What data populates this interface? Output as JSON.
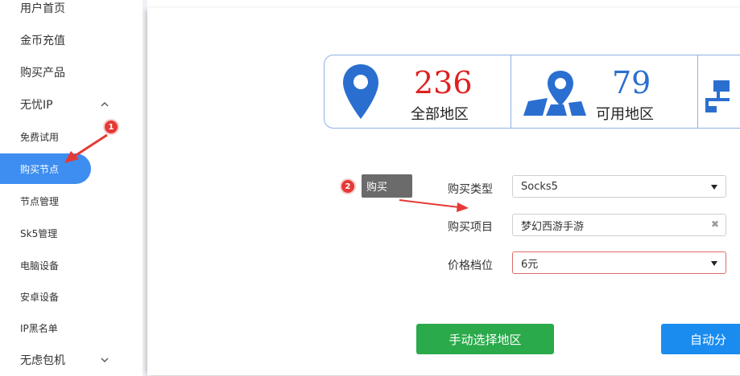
{
  "sidebar": {
    "items": [
      {
        "label": "用户首页",
        "icon": "",
        "sub": false
      },
      {
        "label": "金币充值",
        "icon": "",
        "sub": false
      },
      {
        "label": "购买产品",
        "icon": "",
        "sub": false
      },
      {
        "label": "无忧IP",
        "icon": "chevron-up-icon",
        "sub": false
      },
      {
        "label": "免费试用",
        "icon": "",
        "sub": true
      },
      {
        "label": "购买节点",
        "icon": "",
        "sub": true,
        "active": true
      },
      {
        "label": "节点管理",
        "icon": "",
        "sub": true
      },
      {
        "label": "Sk5管理",
        "icon": "",
        "sub": true
      },
      {
        "label": "电脑设备",
        "icon": "",
        "sub": true
      },
      {
        "label": "安卓设备",
        "icon": "",
        "sub": true
      },
      {
        "label": "IP黑名单",
        "icon": "",
        "sub": true
      },
      {
        "label": "无虑包机",
        "icon": "chevron-down-icon",
        "sub": false
      }
    ]
  },
  "stats": {
    "all_regions": {
      "value": "236",
      "label": "全部地区",
      "icon": "location-pin-icon"
    },
    "available_regions": {
      "value": "79",
      "label": "可用地区",
      "icon": "map-pin-icon"
    }
  },
  "annotations": {
    "badge1": "1",
    "badge2": "2",
    "tooltip": "购买"
  },
  "form": {
    "type_label": "购买类型",
    "type_value": "Socks5",
    "project_label": "购买项目",
    "project_value": "梦幻西游手游",
    "price_label": "价格档位",
    "price_value": "6元"
  },
  "buttons": {
    "manual": "手动选择地区",
    "auto": "自动分"
  },
  "colors": {
    "accent_blue": "#3d8ef0",
    "stat_red": "#e02020",
    "stat_blue": "#2a6fd0",
    "green": "#2aaa4a",
    "annotation_red": "#e53935"
  }
}
